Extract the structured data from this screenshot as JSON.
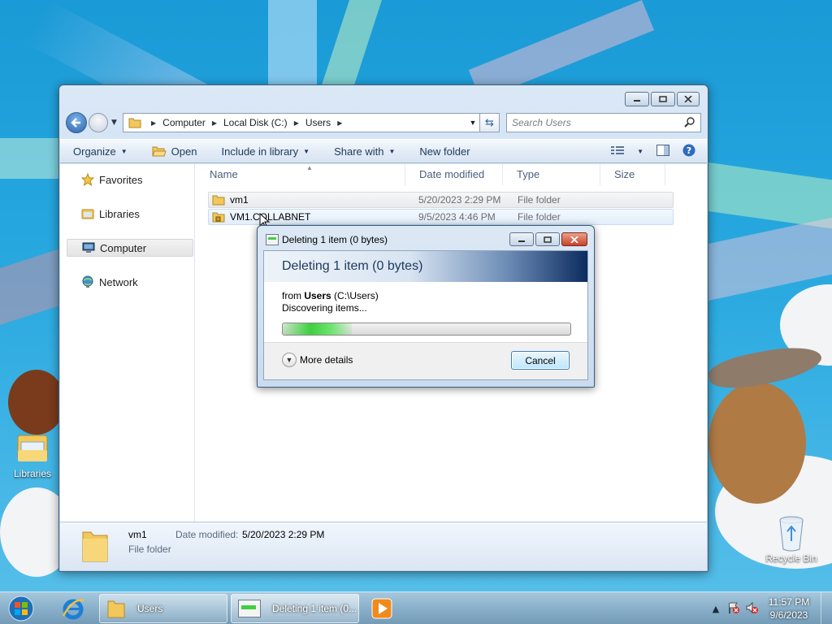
{
  "desktop": {
    "icons": [
      {
        "label": "Libraries"
      },
      {
        "label": "Recycle Bin"
      }
    ]
  },
  "explorer": {
    "breadcrumb": [
      "Computer",
      "Local Disk (C:)",
      "Users"
    ],
    "search_placeholder": "Search Users",
    "toolbar": {
      "organize": "Organize",
      "open": "Open",
      "include_in_library": "Include in library",
      "share_with": "Share with",
      "new_folder": "New folder"
    },
    "nav": {
      "favorites": "Favorites",
      "libraries": "Libraries",
      "computer": "Computer",
      "network": "Network"
    },
    "columns": {
      "name": "Name",
      "date_modified": "Date modified",
      "type": "Type",
      "size": "Size"
    },
    "rows": [
      {
        "name": "vm1",
        "date": "5/20/2023 2:29 PM",
        "type": "File folder"
      },
      {
        "name": "VM1.COLLABNET",
        "date": "9/5/2023 4:46 PM",
        "type": "File folder"
      }
    ],
    "details": {
      "name": "vm1",
      "type": "File folder",
      "date_label": "Date modified:",
      "date_value": "5/20/2023 2:29 PM"
    }
  },
  "dialog": {
    "title": "Deleting 1 item (0 bytes)",
    "heading": "Deleting 1 item (0 bytes)",
    "from_prefix": "from",
    "from_folder": "Users",
    "from_path": "(C:\\Users)",
    "status": "Discovering items...",
    "progress_fraction": 0.24,
    "more_details": "More details",
    "cancel": "Cancel"
  },
  "taskbar": {
    "tasks": [
      {
        "label": "Users"
      },
      {
        "label": "Deleting 1 item (0..."
      }
    ],
    "clock_time": "11:57 PM",
    "clock_date": "9/6/2023"
  },
  "colors": {
    "desktop_sky": "#29a9e0",
    "window_frame": "#c8dcf1",
    "progress_green": "#3fcf3f",
    "dialog_header_dark": "#0c2b5f"
  }
}
